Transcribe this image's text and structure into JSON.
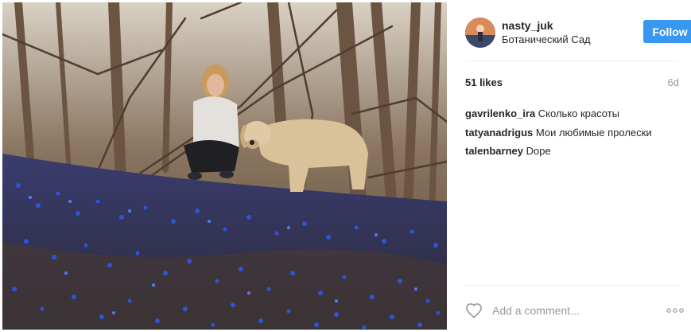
{
  "post": {
    "photo_alt": "Girl and yellow labrador in a forest clearing with blue scilla flowers",
    "author": {
      "username": "nasty_juk",
      "location": "Ботанический Сад"
    },
    "follow_label": "Follow",
    "likes": "51 likes",
    "time": "6d",
    "comments": [
      {
        "author": "gavrilenko_ira",
        "text": "Сколько красоты"
      },
      {
        "author": "tatyanadrigus",
        "text": "Мои любимые пролески"
      },
      {
        "author": "talenbarney",
        "text": "Dope"
      }
    ],
    "add_comment_placeholder": "Add a comment...",
    "icons": {
      "like": "heart-icon",
      "more": "more-icon"
    },
    "colors": {
      "follow_button": "#3897f0",
      "text": "#262626",
      "muted": "#999999",
      "divider": "#efefef"
    }
  }
}
